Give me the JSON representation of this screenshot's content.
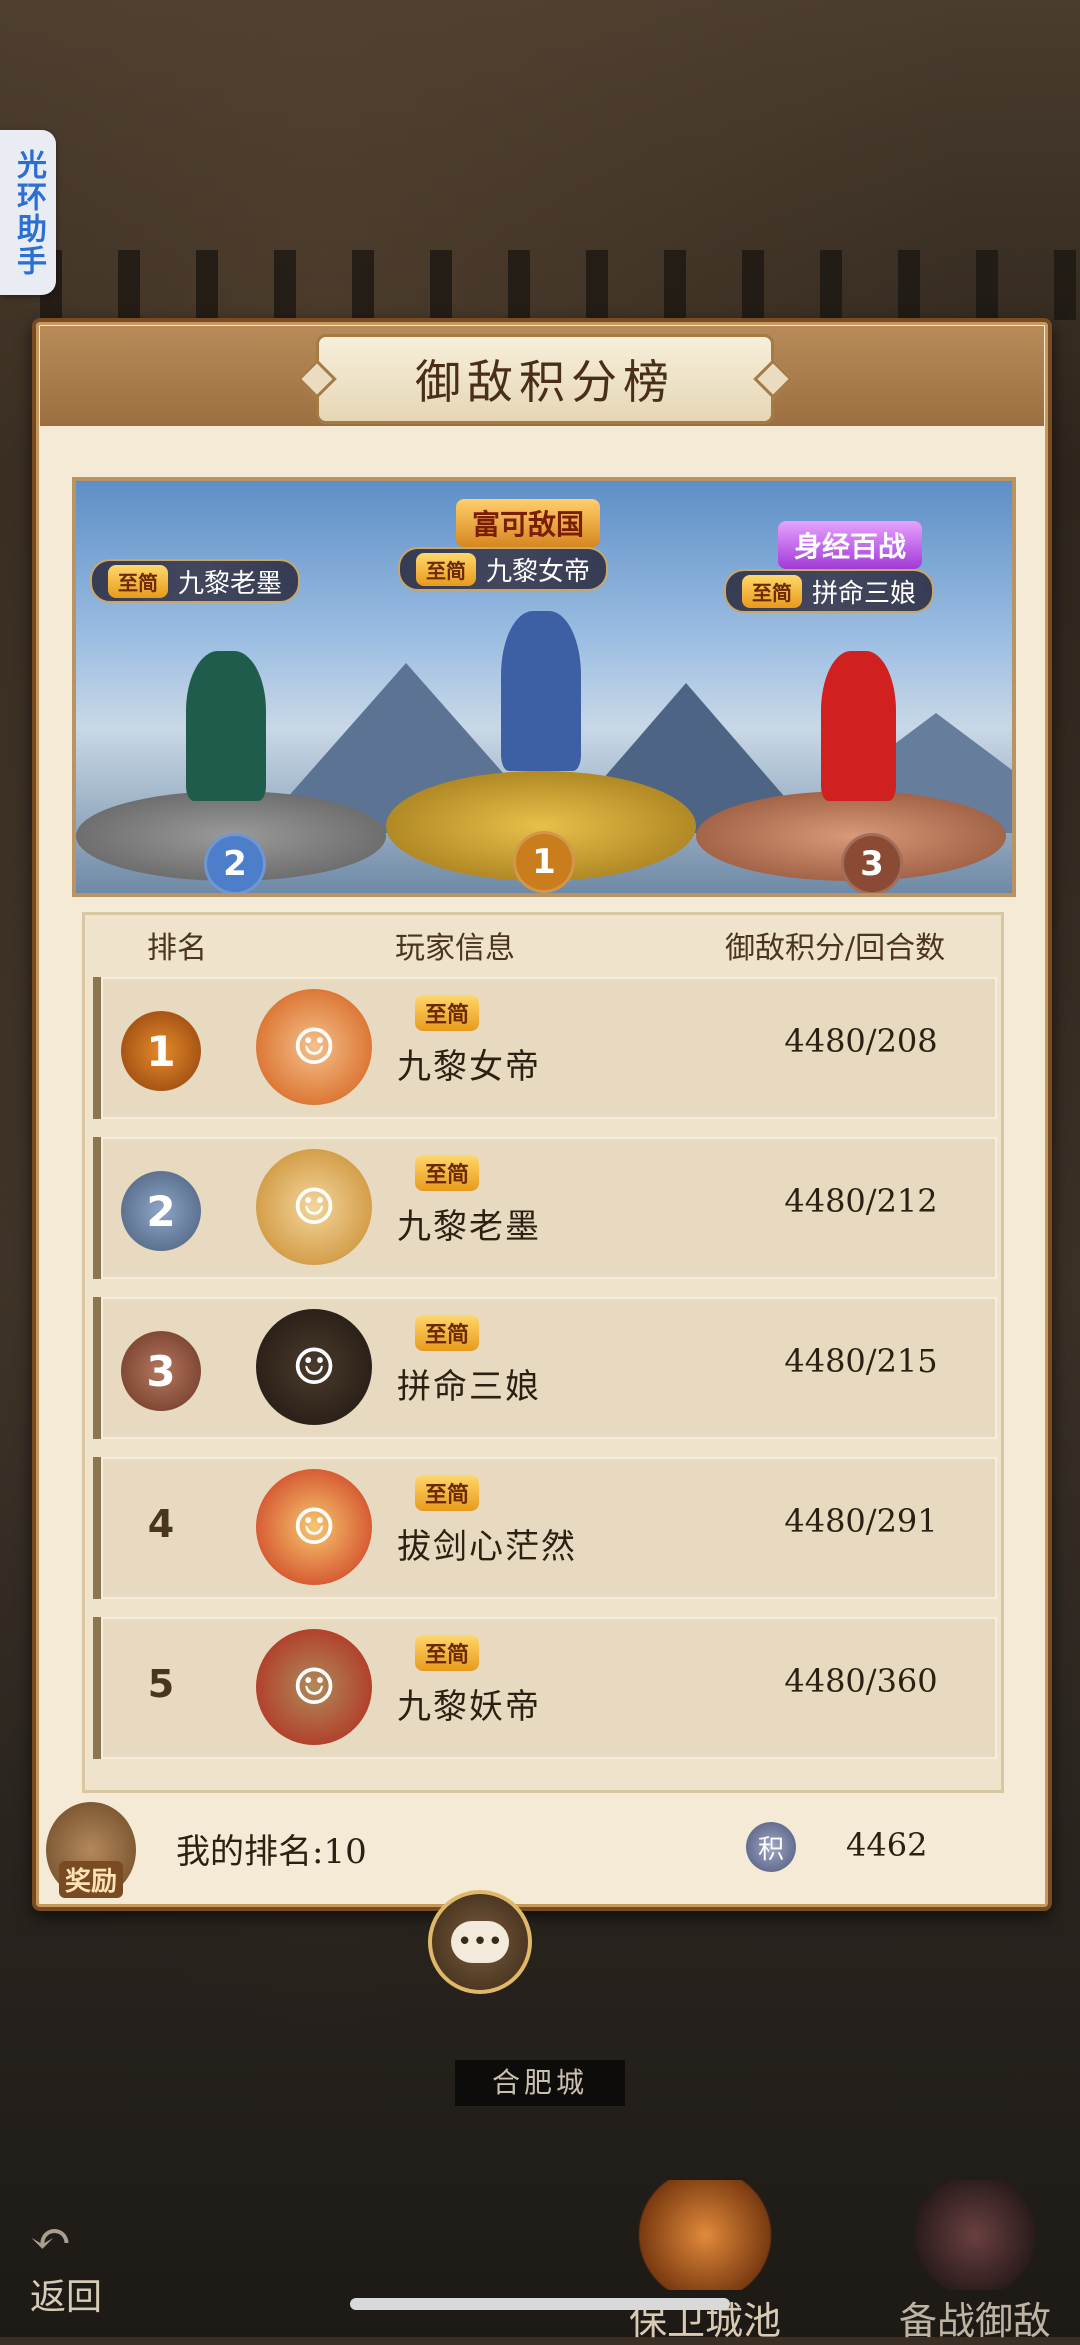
{
  "helper": {
    "label": "光环助手"
  },
  "panel": {
    "title": "御敌积分榜"
  },
  "podium": [
    {
      "rank": "1",
      "badge": "至简",
      "name": "九黎女帝",
      "title_banner": "富可敌国"
    },
    {
      "rank": "2",
      "badge": "至简",
      "name": "九黎老墨"
    },
    {
      "rank": "3",
      "badge": "至简",
      "name": "拼命三娘",
      "title_banner": "身经百战"
    }
  ],
  "table": {
    "headers": {
      "rank": "排名",
      "player": "玩家信息",
      "score": "御敌积分/回合数"
    },
    "rows": [
      {
        "rank": "1",
        "badge": "至简",
        "name": "九黎女帝",
        "score": "4480/208"
      },
      {
        "rank": "2",
        "badge": "至简",
        "name": "九黎老墨",
        "score": "4480/212"
      },
      {
        "rank": "3",
        "badge": "至简",
        "name": "拼命三娘",
        "score": "4480/215"
      },
      {
        "rank": "4",
        "badge": "至简",
        "name": "拔剑心茫然",
        "score": "4480/291"
      },
      {
        "rank": "5",
        "badge": "至简",
        "name": "九黎妖帝",
        "score": "4480/360"
      }
    ]
  },
  "footer": {
    "reward_label": "奖励",
    "my_rank": "我的排名:10",
    "points_icon": "积",
    "points": "4462"
  },
  "city": {
    "label": "合肥城"
  },
  "bottom": {
    "back_label": "返回",
    "defend_label": "保卫城池",
    "prepare_label": "备战御敌"
  },
  "colors": {
    "gold": "#e3a62a",
    "silver": "#8d9bb0",
    "bronze": "#8b4a33",
    "panel_bg": "#f4ead6",
    "frame": "#7a4a22"
  }
}
